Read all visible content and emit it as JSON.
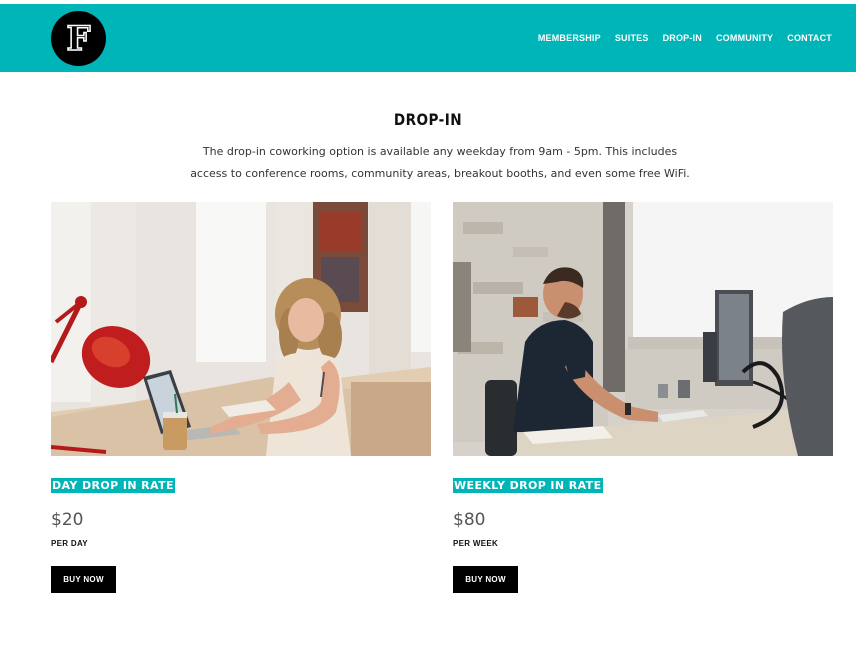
{
  "header": {
    "logo_letter": "F",
    "nav": [
      "MEMBERSHIP",
      "SUITES",
      "DROP-IN",
      "COMMUNITY",
      "CONTACT"
    ],
    "brand_color": "#00b5b8"
  },
  "main": {
    "title": "DROP-IN",
    "intro_line1": "The drop-in coworking option is available any weekday from 9am - 5pm. This includes",
    "intro_line2": "access to conference rooms, community areas, breakout booths, and even some free WiFi."
  },
  "cards": [
    {
      "title": "DAY DROP IN RATE",
      "price": "$20",
      "unit": "PER DAY",
      "button": "BUY NOW",
      "photo": "woman-working-at-laptop-photo"
    },
    {
      "title": "WEEKLY DROP IN RATE",
      "price": "$80",
      "unit": "PER WEEK",
      "button": "BUY NOW",
      "photo": "man-working-at-desktop-photo"
    }
  ]
}
